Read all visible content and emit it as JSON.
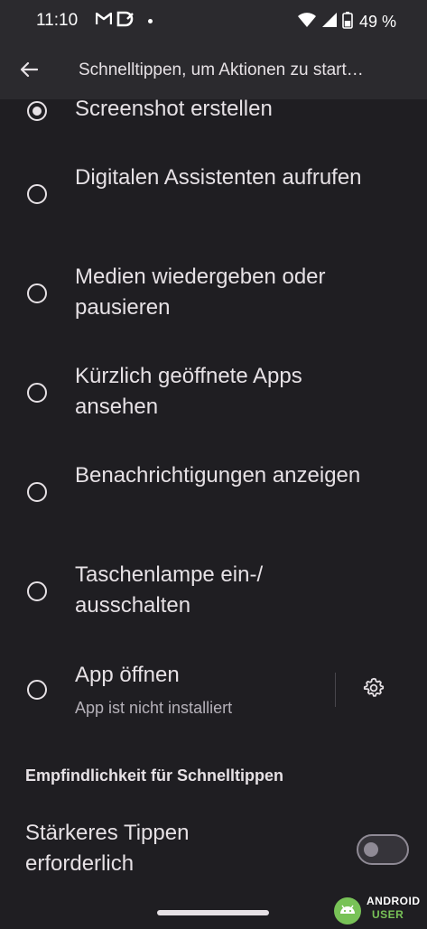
{
  "status_bar": {
    "time": "11:10",
    "battery_percent": "49 %",
    "notification_icons": [
      "gmail-icon",
      "d-app-icon",
      "dot-icon"
    ],
    "system_icons": [
      "wifi-icon",
      "signal-icon",
      "battery-icon"
    ]
  },
  "app_bar": {
    "title": "Schnelltippen, um Aktionen zu start…"
  },
  "options": [
    {
      "label": "Screenshot erstellen",
      "selected": true
    },
    {
      "label": "Digitalen Assistenten aufrufen",
      "selected": false
    },
    {
      "label": "Medien wiedergeben oder pausieren",
      "selected": false
    },
    {
      "label": "Kürzlich geöffnete Apps ansehen",
      "selected": false
    },
    {
      "label": "Benachrichtigungen anzeigen",
      "selected": false
    },
    {
      "label": "Taschenlampe ein-/ ausschalten",
      "selected": false
    },
    {
      "label": "App öffnen",
      "sublabel": "App ist nicht installiert",
      "selected": false
    }
  ],
  "sensitivity": {
    "header": "Empfindlichkeit für Schnelltippen",
    "toggle_label": "Stärkeres Tippen erforderlich",
    "toggle_on": false
  },
  "watermark": {
    "line1": "ANDROID",
    "line2": "USER"
  },
  "colors": {
    "background": "#1f1e22",
    "app_bar": "#2b2a2e",
    "text": "#e6e1e5",
    "secondary_text": "#b5b1b9",
    "toggle_outline": "#8f8a95",
    "watermark_green": "#78c257"
  }
}
